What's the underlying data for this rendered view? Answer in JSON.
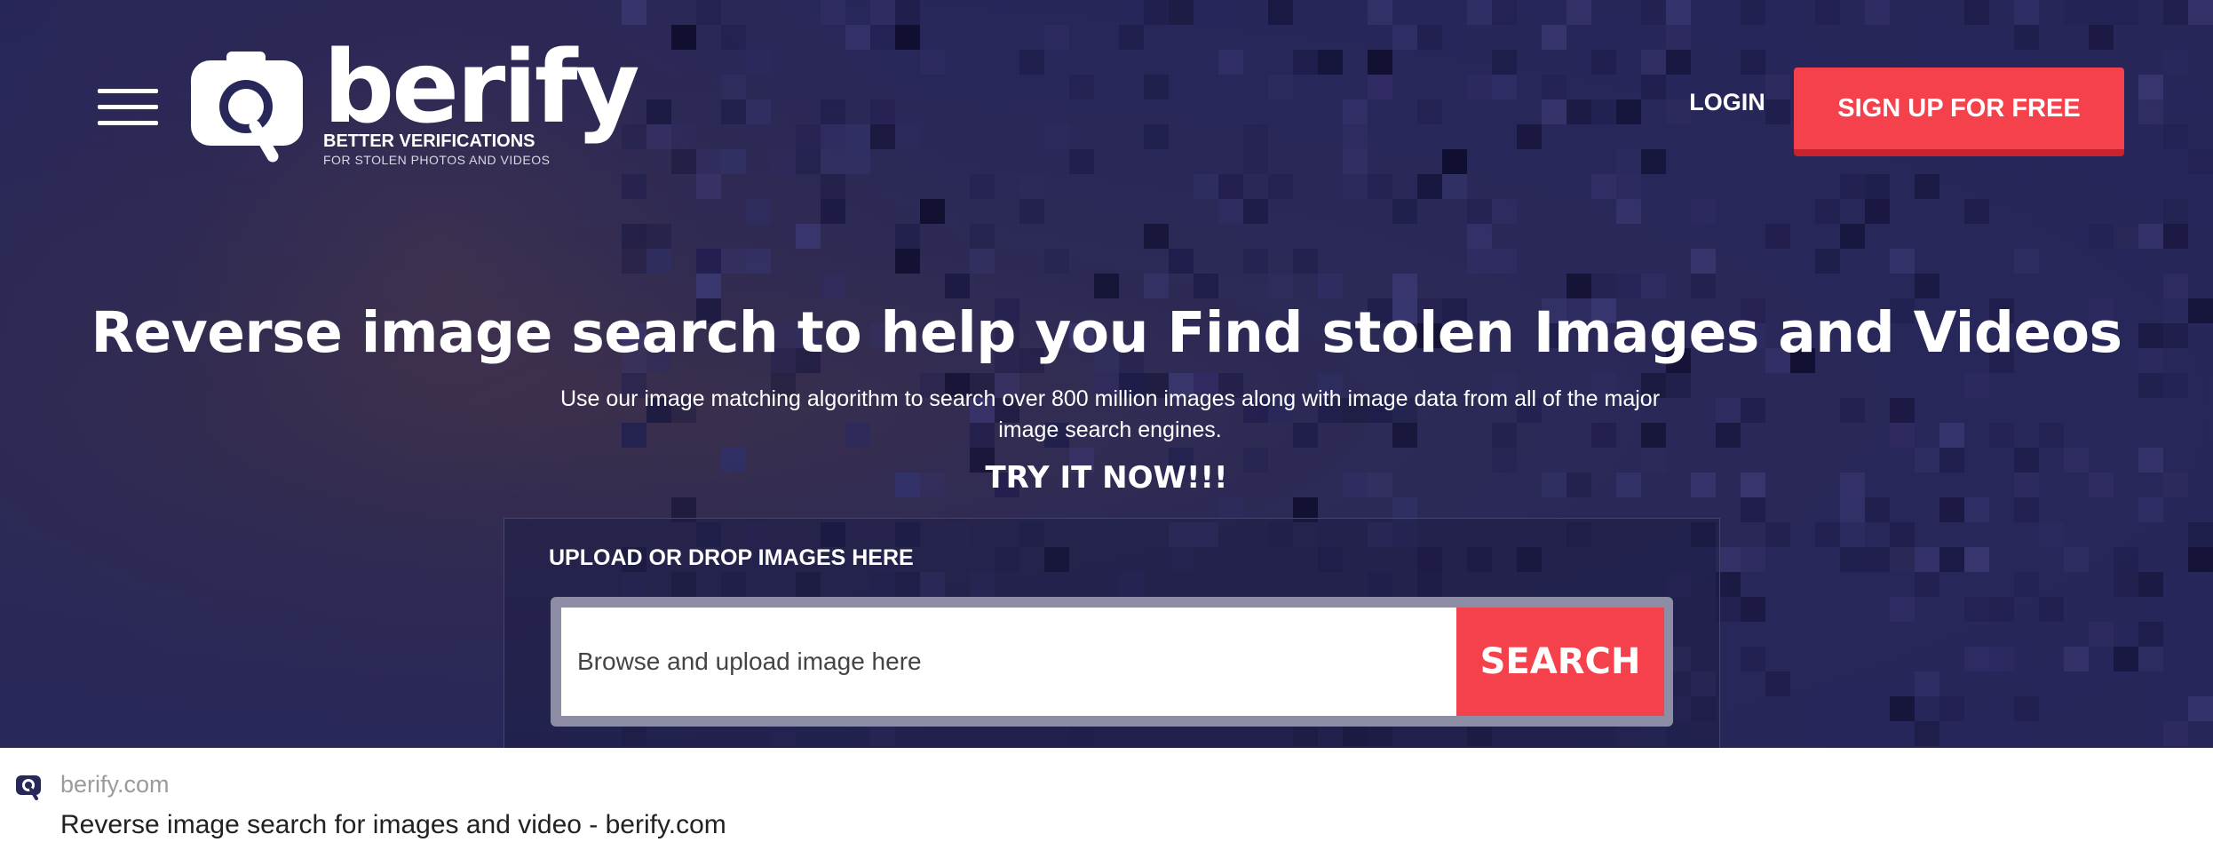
{
  "header": {
    "menu_icon": "hamburger-icon",
    "logo": {
      "word": "berify",
      "tagline": "BETTER VERIFICATIONS",
      "subtagline": "FOR STOLEN PHOTOS AND VIDEOS",
      "icon": "magnifier-camera-icon"
    },
    "login_label": "LOGIN",
    "signup_label": "SIGN UP FOR FREE"
  },
  "hero": {
    "headline": "Reverse image search to help you Find stolen Images and Videos",
    "subtext": "Use our image matching algorithm to search over 800 million images along with image data from all of the major image search engines.",
    "cta": "TRY IT NOW!!!"
  },
  "upload": {
    "label": "UPLOAD OR DROP IMAGES HERE",
    "placeholder": "Browse and upload image here",
    "button": "SEARCH"
  },
  "search_result": {
    "favicon": "berify-favicon-icon",
    "domain": "berify.com",
    "title": "Reverse image search for images and video - berify.com"
  },
  "colors": {
    "hero_bg": "#28275a",
    "accent": "#f5414b",
    "accent_dark": "#c8232c",
    "text_light": "#ffffff"
  }
}
